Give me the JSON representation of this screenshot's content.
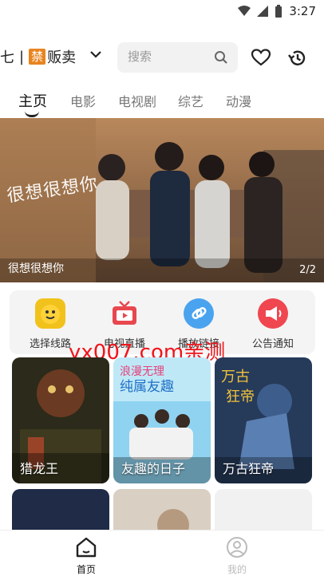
{
  "status": {
    "time": "3:27"
  },
  "header": {
    "brand_left": "七",
    "brand_sep": "|",
    "brand_badge": "禁",
    "brand_right": "贩卖",
    "search_placeholder": "搜索"
  },
  "tabs": [
    {
      "label": "主页",
      "active": true
    },
    {
      "label": "电影",
      "active": false
    },
    {
      "label": "电视剧",
      "active": false
    },
    {
      "label": "综艺",
      "active": false
    },
    {
      "label": "动漫",
      "active": false
    }
  ],
  "banner": {
    "title_art": "很想很想你",
    "caption": "很想很想你",
    "pager": "2/2"
  },
  "shortcuts": [
    {
      "label": "选择线路",
      "icon": "route-select-icon"
    },
    {
      "label": "电视直播",
      "icon": "tv-live-icon"
    },
    {
      "label": "播放链接",
      "icon": "link-icon"
    },
    {
      "label": "公告通知",
      "icon": "megaphone-icon"
    }
  ],
  "watermark": "yx007.com亲测",
  "cards": [
    {
      "title": "猎龙王"
    },
    {
      "title": "友趣的日子"
    },
    {
      "title": "万古狂帝"
    }
  ],
  "nav": [
    {
      "label": "首页",
      "active": true
    },
    {
      "label": "我的",
      "active": false
    }
  ],
  "colors": {
    "accent": "#e8841f",
    "watermark": "#f0151c",
    "active_text": "#111111",
    "inactive_text": "#777777"
  }
}
